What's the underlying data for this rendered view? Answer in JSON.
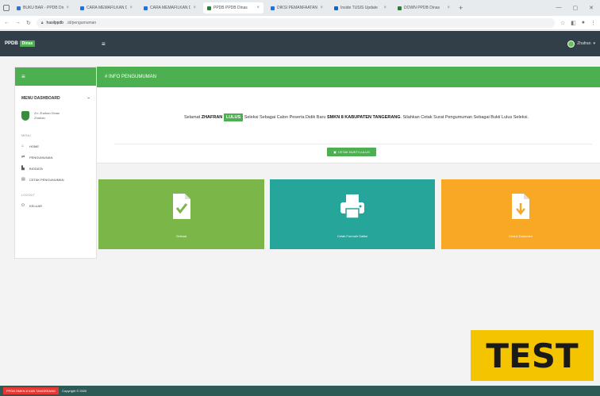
{
  "browser": {
    "tabs": [
      {
        "label": "BUKU BAR - PPDB Dinas",
        "color": "#3c6fd1",
        "active": false
      },
      {
        "label": "CARA MEMAFILKAN DATA",
        "color": "#1a73e8",
        "active": false
      },
      {
        "label": "CARA MEMAFILKAN DATA",
        "color": "#1a73e8",
        "active": false
      },
      {
        "label": "PPDB PPDB Dinas",
        "color": "#2e7d32",
        "active": true
      },
      {
        "label": "DIKSI PEMANFAATAN",
        "color": "#1a73e8",
        "active": false
      },
      {
        "label": "Inside TUSIS Update",
        "color": "#1565c0",
        "active": false
      },
      {
        "label": "DOWN PPDB Dinas",
        "color": "#2e7d32",
        "active": false
      }
    ],
    "url_host": "hasilppdb",
    "url_rest": ".id/pengumuman"
  },
  "app": {
    "brand": "PPDB",
    "brand_badge": "Dinas",
    "user": "Zhafran",
    "info_title": "# INFO PENGUMUMAN",
    "sidebar_title": "MENU DASHBOARD",
    "profile_line1": "Zn: Zhafran Dinas",
    "profile_line2": "Zhafran",
    "separator_1": "MENU",
    "separator_2": "LOGOUT",
    "nav": [
      {
        "label": "HOME",
        "icon": "⌂"
      },
      {
        "label": "PENGUMUMAN",
        "icon": "⇄"
      },
      {
        "label": "BIODATA",
        "icon": "▙"
      },
      {
        "label": "CETAK PENGUMUMAN",
        "icon": "▤"
      }
    ],
    "nav_keluar": {
      "label": "KELUAR",
      "icon": "⏻"
    }
  },
  "announcement": {
    "prefix": "Selamat",
    "name": "ZHAFRAN",
    "status": "LULUS",
    "middle": "Seleksi Sebagai Calon Peserta Didik Baru",
    "school": "SMKN 8 KABUPATEN TANGERANG",
    "suffix": "Silahkan Cetak Surat Pengumuman Sebagai Bukti Lulus Seleksi.",
    "button": "CETAK BUKTI LULUS"
  },
  "cards": [
    {
      "label": "Selesai",
      "color": "#7ab648",
      "icon": "document-check-icon"
    },
    {
      "label": "Cetak Formulir Daftar",
      "color": "#26a69a",
      "icon": "printer-icon"
    },
    {
      "label": "Unduh Dokumen",
      "color": "#f9a825",
      "icon": "download-document-icon"
    }
  ],
  "overlay": {
    "text": "TEST"
  },
  "footer": {
    "badge": "PPDB SMKN 8 KAB TANGERANG",
    "copyright": "Copyright © 2020"
  }
}
